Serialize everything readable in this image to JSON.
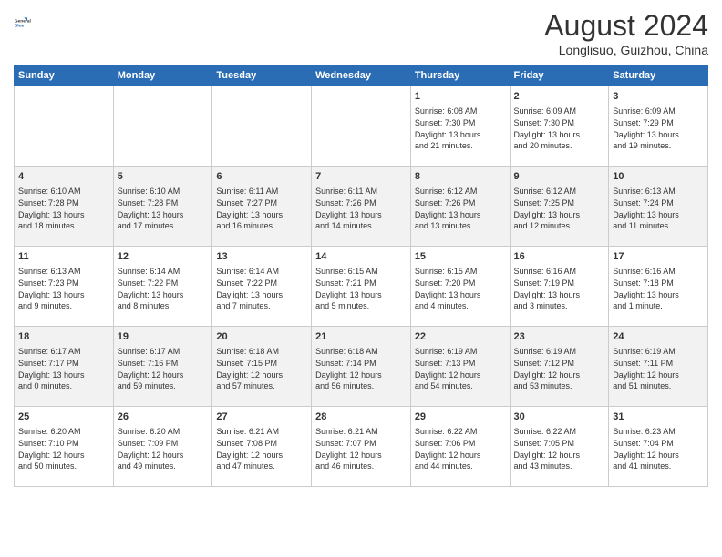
{
  "logo": {
    "line1": "General",
    "line2": "Blue"
  },
  "title": "August 2024",
  "location": "Longlisuo, Guizhou, China",
  "weekdays": [
    "Sunday",
    "Monday",
    "Tuesday",
    "Wednesday",
    "Thursday",
    "Friday",
    "Saturday"
  ],
  "weeks": [
    [
      {
        "day": "",
        "content": ""
      },
      {
        "day": "",
        "content": ""
      },
      {
        "day": "",
        "content": ""
      },
      {
        "day": "",
        "content": ""
      },
      {
        "day": "1",
        "content": "Sunrise: 6:08 AM\nSunset: 7:30 PM\nDaylight: 13 hours\nand 21 minutes."
      },
      {
        "day": "2",
        "content": "Sunrise: 6:09 AM\nSunset: 7:30 PM\nDaylight: 13 hours\nand 20 minutes."
      },
      {
        "day": "3",
        "content": "Sunrise: 6:09 AM\nSunset: 7:29 PM\nDaylight: 13 hours\nand 19 minutes."
      }
    ],
    [
      {
        "day": "4",
        "content": "Sunrise: 6:10 AM\nSunset: 7:28 PM\nDaylight: 13 hours\nand 18 minutes."
      },
      {
        "day": "5",
        "content": "Sunrise: 6:10 AM\nSunset: 7:28 PM\nDaylight: 13 hours\nand 17 minutes."
      },
      {
        "day": "6",
        "content": "Sunrise: 6:11 AM\nSunset: 7:27 PM\nDaylight: 13 hours\nand 16 minutes."
      },
      {
        "day": "7",
        "content": "Sunrise: 6:11 AM\nSunset: 7:26 PM\nDaylight: 13 hours\nand 14 minutes."
      },
      {
        "day": "8",
        "content": "Sunrise: 6:12 AM\nSunset: 7:26 PM\nDaylight: 13 hours\nand 13 minutes."
      },
      {
        "day": "9",
        "content": "Sunrise: 6:12 AM\nSunset: 7:25 PM\nDaylight: 13 hours\nand 12 minutes."
      },
      {
        "day": "10",
        "content": "Sunrise: 6:13 AM\nSunset: 7:24 PM\nDaylight: 13 hours\nand 11 minutes."
      }
    ],
    [
      {
        "day": "11",
        "content": "Sunrise: 6:13 AM\nSunset: 7:23 PM\nDaylight: 13 hours\nand 9 minutes."
      },
      {
        "day": "12",
        "content": "Sunrise: 6:14 AM\nSunset: 7:22 PM\nDaylight: 13 hours\nand 8 minutes."
      },
      {
        "day": "13",
        "content": "Sunrise: 6:14 AM\nSunset: 7:22 PM\nDaylight: 13 hours\nand 7 minutes."
      },
      {
        "day": "14",
        "content": "Sunrise: 6:15 AM\nSunset: 7:21 PM\nDaylight: 13 hours\nand 5 minutes."
      },
      {
        "day": "15",
        "content": "Sunrise: 6:15 AM\nSunset: 7:20 PM\nDaylight: 13 hours\nand 4 minutes."
      },
      {
        "day": "16",
        "content": "Sunrise: 6:16 AM\nSunset: 7:19 PM\nDaylight: 13 hours\nand 3 minutes."
      },
      {
        "day": "17",
        "content": "Sunrise: 6:16 AM\nSunset: 7:18 PM\nDaylight: 13 hours\nand 1 minute."
      }
    ],
    [
      {
        "day": "18",
        "content": "Sunrise: 6:17 AM\nSunset: 7:17 PM\nDaylight: 13 hours\nand 0 minutes."
      },
      {
        "day": "19",
        "content": "Sunrise: 6:17 AM\nSunset: 7:16 PM\nDaylight: 12 hours\nand 59 minutes."
      },
      {
        "day": "20",
        "content": "Sunrise: 6:18 AM\nSunset: 7:15 PM\nDaylight: 12 hours\nand 57 minutes."
      },
      {
        "day": "21",
        "content": "Sunrise: 6:18 AM\nSunset: 7:14 PM\nDaylight: 12 hours\nand 56 minutes."
      },
      {
        "day": "22",
        "content": "Sunrise: 6:19 AM\nSunset: 7:13 PM\nDaylight: 12 hours\nand 54 minutes."
      },
      {
        "day": "23",
        "content": "Sunrise: 6:19 AM\nSunset: 7:12 PM\nDaylight: 12 hours\nand 53 minutes."
      },
      {
        "day": "24",
        "content": "Sunrise: 6:19 AM\nSunset: 7:11 PM\nDaylight: 12 hours\nand 51 minutes."
      }
    ],
    [
      {
        "day": "25",
        "content": "Sunrise: 6:20 AM\nSunset: 7:10 PM\nDaylight: 12 hours\nand 50 minutes."
      },
      {
        "day": "26",
        "content": "Sunrise: 6:20 AM\nSunset: 7:09 PM\nDaylight: 12 hours\nand 49 minutes."
      },
      {
        "day": "27",
        "content": "Sunrise: 6:21 AM\nSunset: 7:08 PM\nDaylight: 12 hours\nand 47 minutes."
      },
      {
        "day": "28",
        "content": "Sunrise: 6:21 AM\nSunset: 7:07 PM\nDaylight: 12 hours\nand 46 minutes."
      },
      {
        "day": "29",
        "content": "Sunrise: 6:22 AM\nSunset: 7:06 PM\nDaylight: 12 hours\nand 44 minutes."
      },
      {
        "day": "30",
        "content": "Sunrise: 6:22 AM\nSunset: 7:05 PM\nDaylight: 12 hours\nand 43 minutes."
      },
      {
        "day": "31",
        "content": "Sunrise: 6:23 AM\nSunset: 7:04 PM\nDaylight: 12 hours\nand 41 minutes."
      }
    ]
  ]
}
